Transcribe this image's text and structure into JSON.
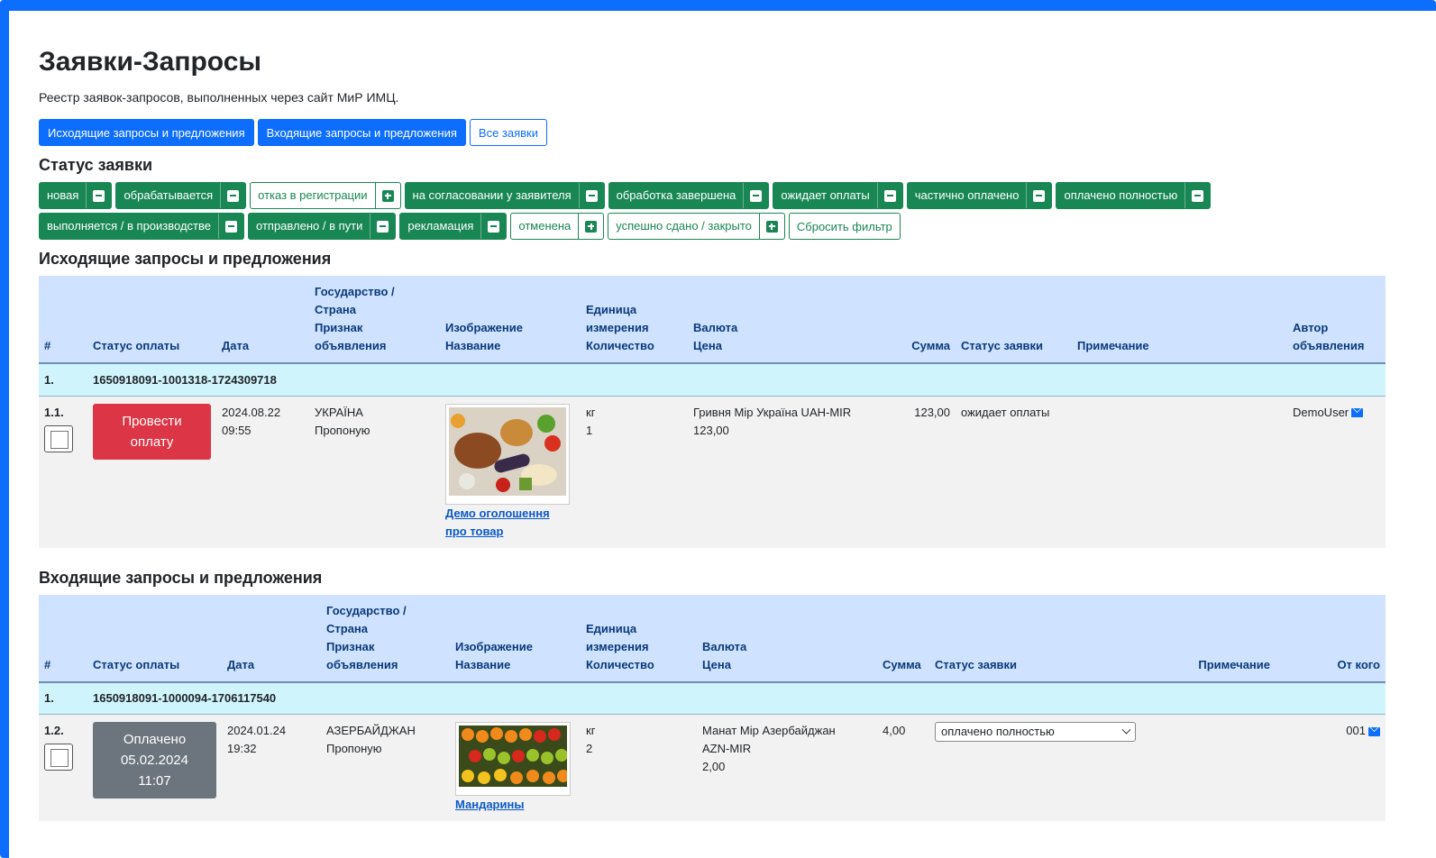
{
  "page": {
    "title": "Заявки-Запросы",
    "subtitle": "Реестр заявок-запросов, выполненных через сайт МиР ИМЦ."
  },
  "tabs": [
    "Исходящие запросы и предложения",
    "Входящие запросы и предложения",
    "Все заявки"
  ],
  "status_heading": "Статус заявки",
  "filters": {
    "new": "новая",
    "processing": "обрабатывается",
    "rejected": "отказ в регистрации",
    "approval": "на согласовании у заявителя",
    "done": "обработка завершена",
    "awaiting": "ожидает оплаты",
    "partial": "частично оплачено",
    "paid": "оплачено полностью",
    "production": "выполняется / в производстве",
    "shipped": "отправлено / в пути",
    "claim": "рекламация",
    "cancelled": "отменена",
    "closed": "успешно сдано / закрыто",
    "reset": "Сбросить фильтр"
  },
  "outgoing": {
    "heading": "Исходящие запросы и предложения",
    "headers": {
      "num": "#",
      "pay": "Статус оплаты",
      "date": "Дата",
      "country1": "Государство /",
      "country2": "Страна",
      "country3": "Признак",
      "country4": "объявления",
      "img1": "Изображение",
      "img2": "Название",
      "unit1": "Единица",
      "unit2": "измерения",
      "unit3": "Количество",
      "cur1": "Валюта",
      "cur2": "Цена",
      "sum": "Сумма",
      "status": "Статус заявки",
      "note": "Примечание",
      "author1": "Автор",
      "author2": "объявления"
    },
    "group": {
      "num": "1.",
      "id": "1650918091-1001318-1724309718"
    },
    "row": {
      "num": "1.1.",
      "pay_button": "Провести оплату",
      "date": "2024.08.22",
      "time": "09:55",
      "country": "УКРАЇНА",
      "sign": "Пропоную",
      "name_line1": "Демо оголошення",
      "name_line2": "про товар",
      "unit": "кг",
      "qty": "1",
      "currency": "Гривня Мір Україна UAH-MIR",
      "price": "123,00",
      "sum": "123,00",
      "status": "ожидает оплаты",
      "note": "",
      "author": "DemoUser"
    }
  },
  "incoming": {
    "heading": "Входящие запросы и предложения",
    "headers": {
      "num": "#",
      "pay": "Статус оплаты",
      "date": "Дата",
      "country1": "Государство /",
      "country2": "Страна",
      "country3": "Признак",
      "country4": "объявления",
      "img1": "Изображение",
      "img2": "Название",
      "unit1": "Единица",
      "unit2": "измерения",
      "unit3": "Количество",
      "cur1": "Валюта",
      "cur2": "Цена",
      "sum": "Сумма",
      "status": "Статус заявки",
      "note": "Примечание",
      "from": "От кого"
    },
    "group": {
      "num": "1.",
      "id": "1650918091-1000094-1706117540"
    },
    "row": {
      "num": "1.2.",
      "paid_line1": "Оплачено",
      "paid_line2": "05.02.2024",
      "paid_line3": "11:07",
      "date": "2024.01.24",
      "time": "19:32",
      "country": "АЗЕРБАЙДЖАН",
      "sign": "Пропоную",
      "name": "Мандарины",
      "unit": "кг",
      "qty": "2",
      "currency_line1": "Манат Мір Азербайджан",
      "currency_line2": "AZN-MIR",
      "price": "2,00",
      "sum": "4,00",
      "status_select": "оплачено полностью",
      "note": "",
      "from": "001"
    }
  },
  "colors": {
    "primary": "#0d6efd",
    "success": "#198754",
    "danger": "#dc3545",
    "secondary": "#6c757d",
    "header_bg": "#cfe2ff",
    "group_bg": "#cff4fc"
  }
}
